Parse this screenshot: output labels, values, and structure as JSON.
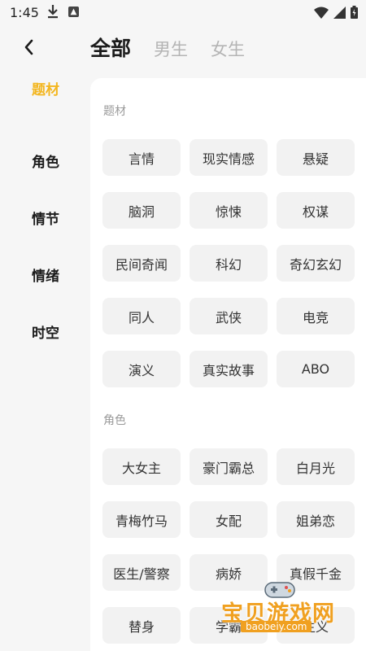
{
  "status_bar": {
    "time": "1:45"
  },
  "nav": {
    "tabs": [
      {
        "label": "全部",
        "active": true
      },
      {
        "label": "男生",
        "active": false
      },
      {
        "label": "女生",
        "active": false
      }
    ]
  },
  "sidebar": {
    "items": [
      {
        "label": "题材",
        "active": true
      },
      {
        "label": "角色",
        "active": false
      },
      {
        "label": "情节",
        "active": false
      },
      {
        "label": "情绪",
        "active": false
      },
      {
        "label": "时空",
        "active": false
      }
    ]
  },
  "sections": [
    {
      "title": "题材",
      "tags": [
        "言情",
        "现实情感",
        "悬疑",
        "脑洞",
        "惊悚",
        "权谋",
        "民间奇闻",
        "科幻",
        "奇幻玄幻",
        "同人",
        "武侠",
        "电竞",
        "演义",
        "真实故事",
        "ABO"
      ]
    },
    {
      "title": "角色",
      "tags": [
        "大女主",
        "豪门霸总",
        "白月光",
        "青梅竹马",
        "女配",
        "姐弟恋",
        "医生/警察",
        "病娇",
        "真假千金",
        "替身",
        "学霸",
        "主义"
      ]
    }
  ],
  "watermark": {
    "text": "宝贝游戏网",
    "url": "baobeiy.com"
  },
  "colors": {
    "accent": "#f3b61f",
    "tag_bg": "#f2f2f2",
    "panel_bg": "#ffffff",
    "page_bg": "#f6f6f6"
  }
}
